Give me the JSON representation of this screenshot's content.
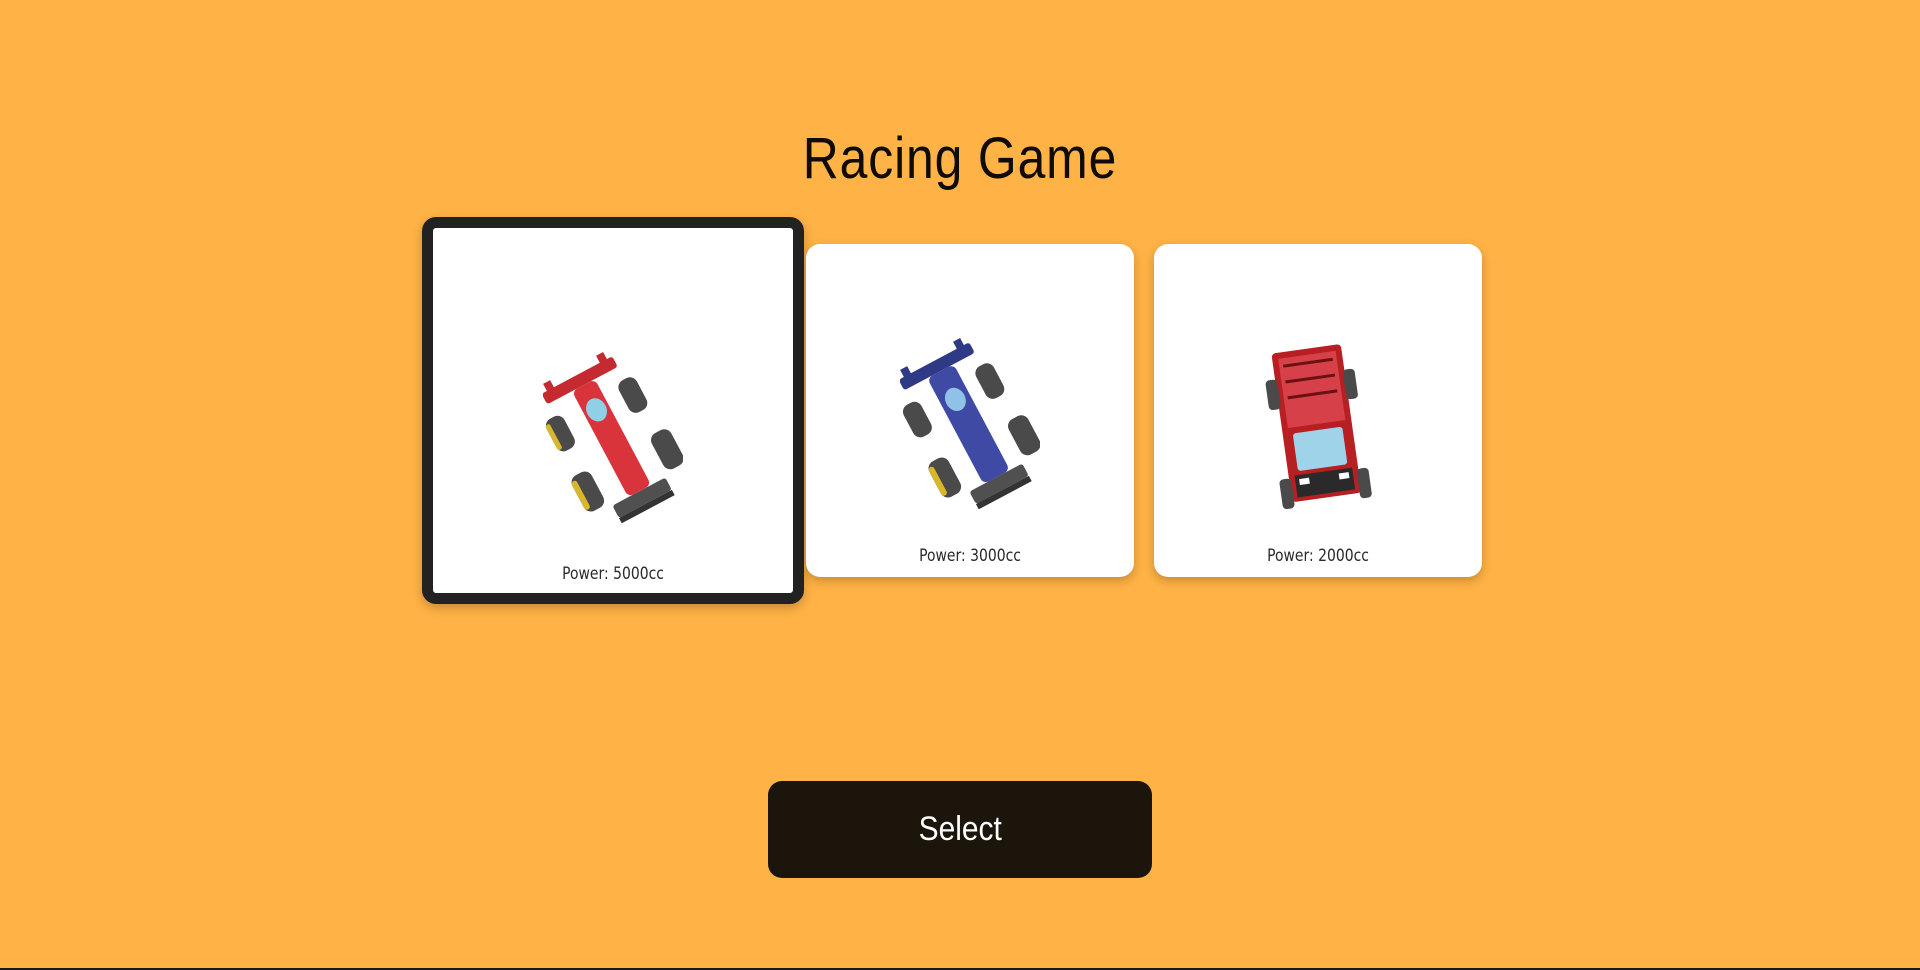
{
  "title": "Racing Game",
  "cars": [
    {
      "power_label": "Power: 5000cc",
      "body_color": "#d9343b",
      "accent_color": "#8fd0e6",
      "selected": true
    },
    {
      "power_label": "Power: 3000cc",
      "body_color": "#3e4aa3",
      "accent_color": "#8fc2e6",
      "selected": false
    },
    {
      "power_label": "Power: 2000cc",
      "body_color": "#b71f22",
      "accent_color": "#9fd3ea",
      "selected": false
    }
  ],
  "select_button": {
    "label": "Select"
  },
  "colors": {
    "background": "#FFB245",
    "selected_border": "#222222",
    "button_bg": "#1C150C"
  }
}
